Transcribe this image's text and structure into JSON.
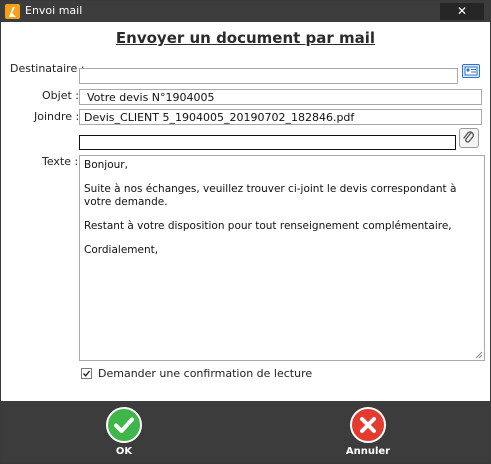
{
  "window": {
    "title": "Envoi mail",
    "close": "✕"
  },
  "heading": "Envoyer un document par mail",
  "form": {
    "destinataire_label": "Destinataire :",
    "destinataire_value": "",
    "objet_label": "Objet :",
    "objet_value": "Votre devis N°1904005",
    "joindre_label": "Joindre :",
    "joindre_value": "Devis_CLIENT 5_1904005_20190702_182846.pdf",
    "joindre_extra_value": "",
    "texte_label": "Texte :",
    "body_lines": [
      "Bonjour,",
      "Suite à nos échanges, veuillez trouver ci-joint le devis correspondant à votre demande.",
      "Restant à votre disposition pour tout renseignement complémentaire,",
      "Cordialement,"
    ]
  },
  "read_receipt": {
    "label": "Demander une confirmation de lecture",
    "checked": true
  },
  "buttons": {
    "ok": "OK",
    "cancel": "Annuler"
  },
  "colors": {
    "ok": "#3fb54a",
    "cancel": "#e53a2f",
    "chrome": "#3c3c3c"
  }
}
